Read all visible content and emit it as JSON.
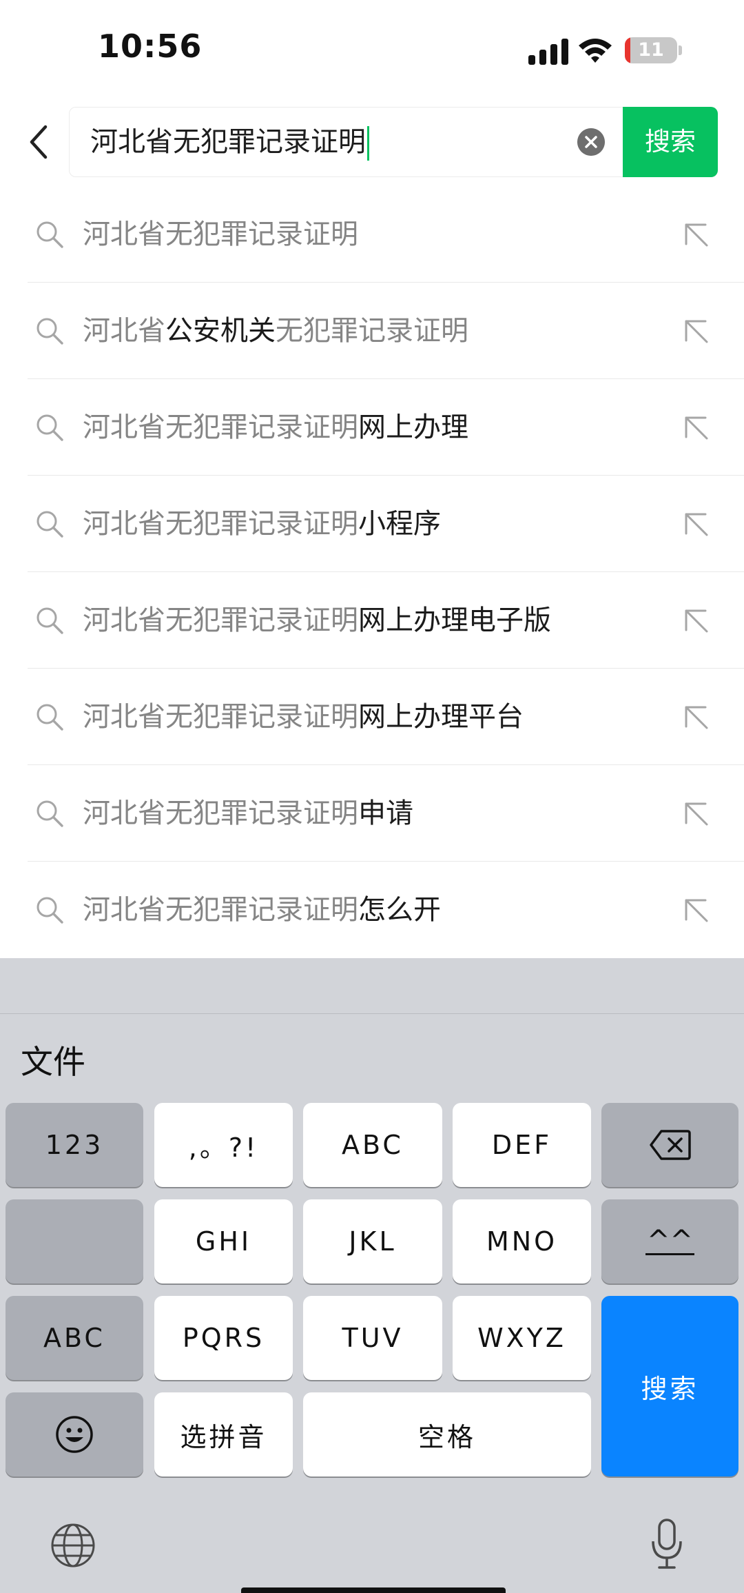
{
  "status_bar": {
    "time": "10:56",
    "battery_level": "11",
    "battery_fraction": 0.11
  },
  "search": {
    "query": "河北省无犯罪记录证明",
    "button_label": "搜索"
  },
  "suggestions": [
    {
      "match": "河北省",
      "rest": "公安机关",
      "tail": "无犯罪记录证明"
    },
    {
      "match": "河北省无犯罪记录证明",
      "rest": "网上办理",
      "tail": ""
    },
    {
      "match": "河北省无犯罪记录证明",
      "rest": "小程序",
      "tail": ""
    },
    {
      "match": "河北省无犯罪记录证明",
      "rest": "网上办理电子版",
      "tail": ""
    },
    {
      "match": "河北省无犯罪记录证明",
      "rest": "网上办理平台",
      "tail": ""
    },
    {
      "match": "河北省无犯罪记录证明",
      "rest": "申请",
      "tail": ""
    },
    {
      "match": "河北省无犯罪记录证明",
      "rest": "怎么开",
      "tail": ""
    }
  ],
  "first_suggestion": "河北省无犯罪记录证明",
  "keyboard": {
    "candidate": "文件",
    "keys": {
      "num": "123",
      "punct": ",。?!",
      "abc": "ABC",
      "def": "DEF",
      "ghi": "GHI",
      "jkl": "JKL",
      "mno": "MNO",
      "emoticon": "^^",
      "abc_switch": "ABC",
      "pqrs": "PQRS",
      "tuv": "TUV",
      "wxyz": "WXYZ",
      "search": "搜索",
      "pinyin": "选拼音",
      "space": "空格"
    }
  },
  "icons": {
    "back": "chevron-left-icon",
    "clear": "clear-circle-icon",
    "search": "search-icon",
    "fill": "arrow-up-left-icon",
    "delete": "backspace-icon",
    "emoji": "emoji-icon",
    "globe": "globe-icon",
    "mic": "microphone-icon"
  },
  "colors": {
    "accent": "#07c160",
    "keyboard_blue": "#0a84ff"
  }
}
